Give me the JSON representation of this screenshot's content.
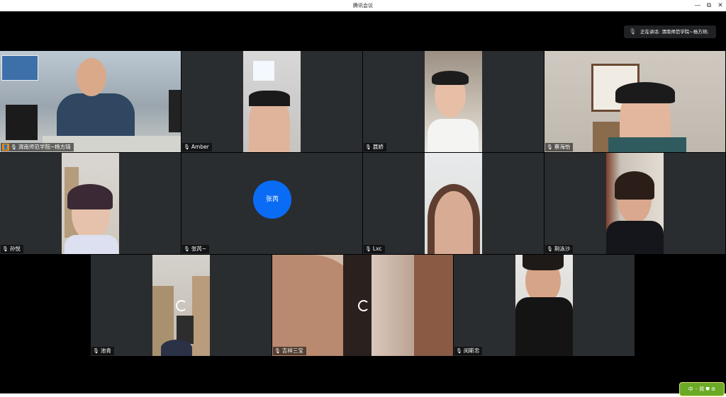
{
  "window": {
    "title": "腾讯会议",
    "minimize": "—",
    "restore": "⧉",
    "close": "✕"
  },
  "speaking": {
    "icon": "mic-icon",
    "text": "正在讲话: 渭南师范学院~杨方琦;"
  },
  "participants": [
    {
      "name": "渭南师范学院~杨方琦",
      "host": true
    },
    {
      "name": "Amber"
    },
    {
      "name": "聂娇"
    },
    {
      "name": "蔡海怡"
    },
    {
      "name": "孙悦"
    },
    {
      "name": "张芮~",
      "avatar_text": "张芮"
    },
    {
      "name": "Lxc"
    },
    {
      "name": "荆泳沙"
    },
    {
      "name": "池青"
    },
    {
      "name": "吉祥三宝"
    },
    {
      "name": "闵斯忠"
    }
  ],
  "badge": {
    "text": "中 ◦ 简 ⛊ ⚙"
  },
  "colors": {
    "tile_bg": "#2a2d30",
    "avatar_blue": "#0a6cf5",
    "active_border": "#2ecc71",
    "host_badge": "#ff8a00"
  }
}
